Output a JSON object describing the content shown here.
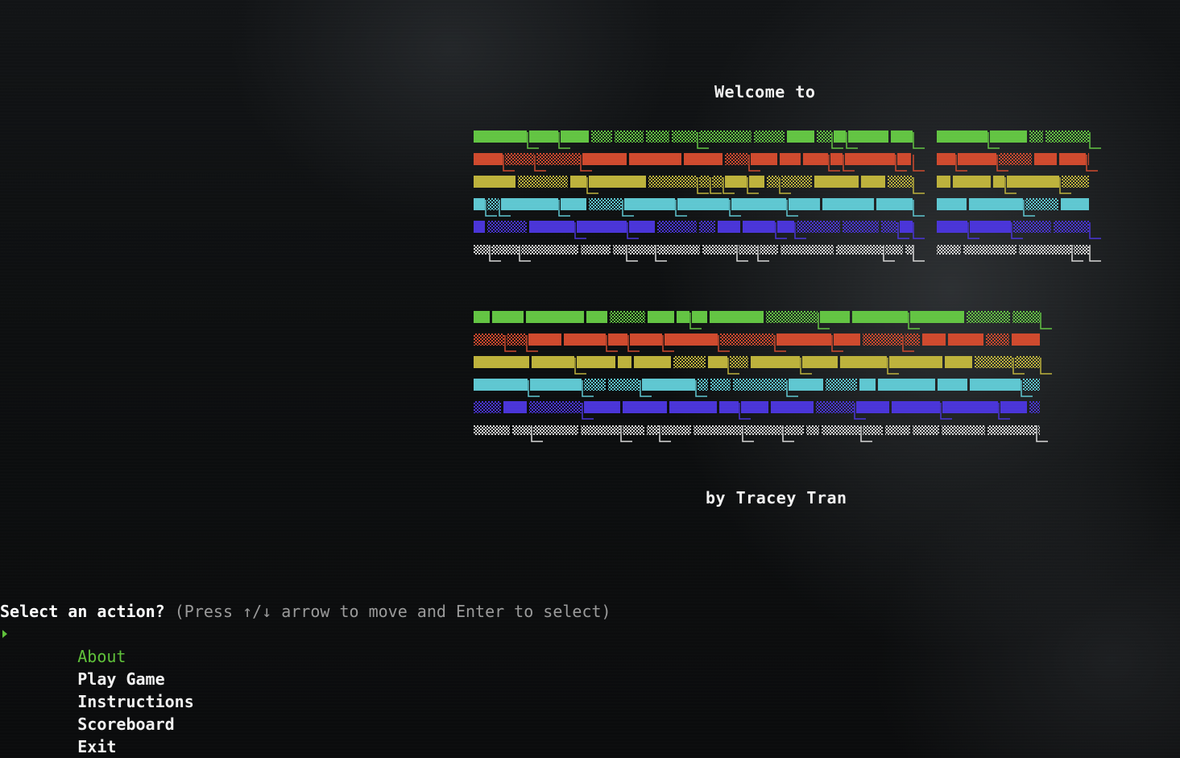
{
  "header": {
    "welcome": "Welcome to"
  },
  "footer": {
    "byline": "by Tracey Tran"
  },
  "prompt": {
    "question": "Select an action?",
    "hint": "(Press ↑/↓ arrow to move and Enter to select)"
  },
  "menu": {
    "pointer_icon": "triangle-right-icon",
    "selected_index": 0,
    "items": [
      {
        "label": "About"
      },
      {
        "label": "Play Game"
      },
      {
        "label": "Instructions"
      },
      {
        "label": "Scoreboard"
      },
      {
        "label": "Exit"
      }
    ]
  },
  "colors": {
    "row_colors": [
      "#63c443",
      "#cf4a2e",
      "#bdb23c",
      "#5fc7d1",
      "#4a35d8",
      "#d8d8d8"
    ],
    "selected": "#5fc13a",
    "hint": "#9a9a9a",
    "text": "#f2f2f2"
  }
}
